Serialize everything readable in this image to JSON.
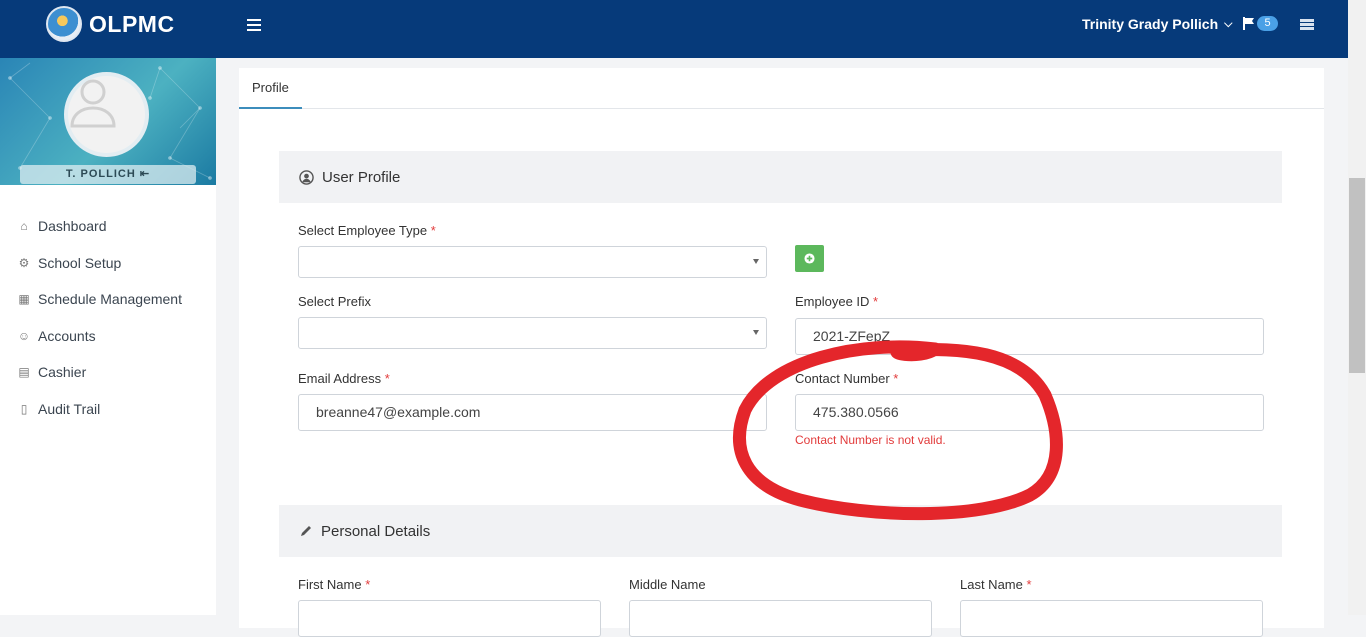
{
  "header": {
    "brand": "OLPMC",
    "user_name": "Trinity Grady Pollich",
    "notification_count": "5"
  },
  "sidebar": {
    "profile_name": "T. POLLICH",
    "items": [
      {
        "label": "Dashboard",
        "icon": "home-icon"
      },
      {
        "label": "School Setup",
        "icon": "gear-icon"
      },
      {
        "label": "Schedule Management",
        "icon": "calendar-icon"
      },
      {
        "label": "Accounts",
        "icon": "users-icon"
      },
      {
        "label": "Cashier",
        "icon": "cashier-icon"
      },
      {
        "label": "Audit Trail",
        "icon": "book-icon"
      }
    ]
  },
  "main": {
    "tab": "Profile",
    "user_profile": {
      "title": "User Profile",
      "employee_type_label": "Select Employee Type",
      "prefix_label": "Select Prefix",
      "employee_id_label": "Employee ID",
      "employee_id_value": "2021-ZFepZ",
      "email_label": "Email Address",
      "email_value": "breanne47@example.com",
      "contact_label": "Contact Number",
      "contact_value": "475.380.0566",
      "contact_error": "Contact Number is not valid."
    },
    "personal_details": {
      "title": "Personal Details",
      "first_name_label": "First Name",
      "middle_name_label": "Middle Name",
      "last_name_label": "Last Name"
    }
  },
  "colors": {
    "topbar": "#063a7a",
    "accent": "#3c8dbc",
    "error": "#e23b3b",
    "success": "#5cb85c",
    "annotation": "#e4262b"
  }
}
